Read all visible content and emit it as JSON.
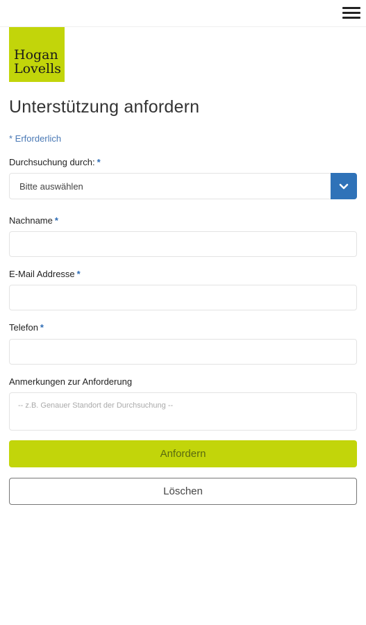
{
  "header": {
    "menu_icon": "hamburger-menu-icon",
    "logo_line1": "Hogan",
    "logo_line2": "Lovells",
    "logo_color": "#c2d50a"
  },
  "form": {
    "title": "Unterstützung anfordern",
    "required_note": "* Erforderlich",
    "search_by": {
      "label": "Durchsuchung durch:",
      "required_marker": "*",
      "selected_value": "Bitte auswählen",
      "arrow_icon": "chevron-down-icon",
      "arrow_color": "#2f72b8"
    },
    "last_name": {
      "label": "Nachname",
      "required_marker": "*",
      "value": ""
    },
    "email": {
      "label": "E-Mail Addresse",
      "required_marker": "*",
      "value": ""
    },
    "phone": {
      "label": "Telefon",
      "required_marker": "*",
      "value": ""
    },
    "notes": {
      "label": "Anmerkungen zur Anforderung",
      "placeholder": "-- z.B. Genauer Standort der Durchsuchung --",
      "value": ""
    },
    "submit_label": "Anfordern",
    "clear_label": "Löschen",
    "accent_color": "#c2d50a"
  }
}
